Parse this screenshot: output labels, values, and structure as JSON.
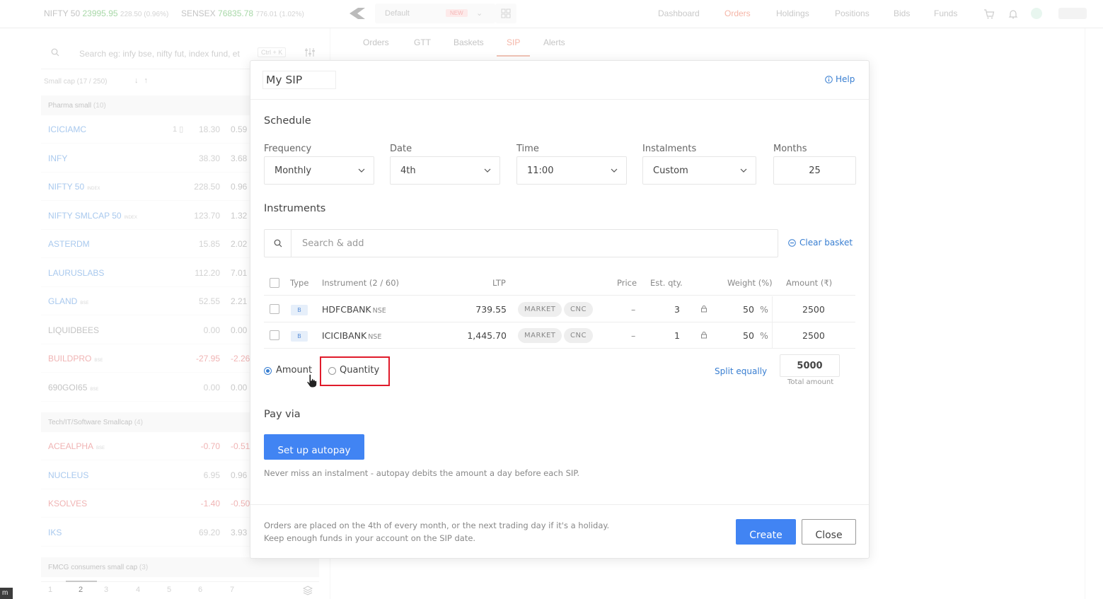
{
  "header": {
    "indices": [
      {
        "name": "NIFTY 50",
        "value": "23995.95",
        "change": "228.50 (0.96%)"
      },
      {
        "name": "SENSEX",
        "value": "76835.78",
        "change": "776.01 (1.02%)"
      }
    ],
    "marketwatch_select": {
      "value": "Default",
      "badge": "NEW"
    },
    "nav": [
      "Dashboard",
      "Orders",
      "Holdings",
      "Positions",
      "Bids",
      "Funds"
    ],
    "active_nav": "Orders"
  },
  "marketwatch": {
    "search_placeholder": "Search eg: infy bse, nifty fut, index fund, et",
    "shortcut": "Ctrl + K",
    "list_header": "Small cap (17 / 250)",
    "groups": [
      {
        "name": "Pharma small",
        "count": "(10)",
        "rows": [
          {
            "symbol": "ICICIAMC",
            "tag": "",
            "holding": "1",
            "ltp": "18.30",
            "pct": "0.59"
          },
          {
            "symbol": "INFY",
            "tag": "",
            "holding": "",
            "ltp": "38.30",
            "pct": "3.68"
          },
          {
            "symbol": "NIFTY 50",
            "tag": "INDEX",
            "holding": "",
            "ltp": "228.50",
            "pct": "0.96"
          },
          {
            "symbol": "NIFTY SMLCAP 50",
            "tag": "INDEX",
            "holding": "",
            "ltp": "123.70",
            "pct": "1.32"
          },
          {
            "symbol": "ASTERDM",
            "tag": "",
            "holding": "",
            "ltp": "15.85",
            "pct": "2.02"
          },
          {
            "symbol": "LAURUSLABS",
            "tag": "",
            "holding": "",
            "ltp": "112.20",
            "pct": "7.01"
          },
          {
            "symbol": "GLAND",
            "tag": "BSE",
            "holding": "",
            "ltp": "52.55",
            "pct": "2.21"
          },
          {
            "symbol": "LIQUIDBEES",
            "tag": "",
            "holding": "",
            "ltp": "0.00",
            "pct": "0.00"
          },
          {
            "symbol": "BUILDPRO",
            "tag": "BSE",
            "holding": "",
            "ltp": "-27.95",
            "pct": "-2.26"
          },
          {
            "symbol": "690GOI65",
            "tag": "BSE",
            "holding": "",
            "ltp": "0.00",
            "pct": "0.00"
          }
        ]
      },
      {
        "name": "Tech/IT/Software Smallcap",
        "count": "(4)",
        "rows": [
          {
            "symbol": "ACEALPHA",
            "tag": "BSE",
            "holding": "",
            "ltp": "-0.70",
            "pct": "-0.51"
          },
          {
            "symbol": "NUCLEUS",
            "tag": "",
            "holding": "",
            "ltp": "6.95",
            "pct": "0.96"
          },
          {
            "symbol": "KSOLVES",
            "tag": "",
            "holding": "",
            "ltp": "-1.40",
            "pct": "-0.50"
          },
          {
            "symbol": "IKS",
            "tag": "",
            "holding": "",
            "ltp": "69.20",
            "pct": "3.93"
          }
        ]
      },
      {
        "name": "FMCG consumers small cap",
        "count": "(3)",
        "rows": []
      }
    ],
    "pages": [
      "1",
      "2",
      "3",
      "4",
      "5",
      "6",
      "7"
    ],
    "active_page": "2"
  },
  "orders_tabs": [
    "Orders",
    "GTT",
    "Baskets",
    "SIP",
    "Alerts"
  ],
  "active_orders_tab": "SIP",
  "sip": {
    "name": "My SIP",
    "help": "Help",
    "schedule_title": "Schedule",
    "fields": [
      {
        "label": "Frequency",
        "value": "Monthly"
      },
      {
        "label": "Date",
        "value": "4th"
      },
      {
        "label": "Time",
        "value": "11:00"
      },
      {
        "label": "Instalments",
        "value": "Custom"
      },
      {
        "label": "Months",
        "value": "25"
      }
    ],
    "instruments_title": "Instruments",
    "search_placeholder": "Search & add",
    "clear_basket": "Clear basket",
    "table": {
      "headers": [
        "Type",
        "Instrument (2 / 60)",
        "LTP",
        "Price",
        "Est. qty.",
        "Weight (%)",
        "Amount (₹)"
      ],
      "rows": [
        {
          "type": "B",
          "instrument": "HDFCBANK",
          "exchange": "NSE",
          "ltp": "739.55",
          "order_type": "MARKET",
          "product": "CNC",
          "price": "–",
          "qty": "3",
          "weight": "50",
          "weight_unit": "%",
          "amount": "2500"
        },
        {
          "type": "B",
          "instrument": "ICICIBANK",
          "exchange": "NSE",
          "ltp": "1,445.70",
          "order_type": "MARKET",
          "product": "CNC",
          "price": "–",
          "qty": "1",
          "weight": "50",
          "weight_unit": "%",
          "amount": "2500"
        }
      ]
    },
    "mode_options": [
      {
        "label": "Amount",
        "selected": true
      },
      {
        "label": "Quantity",
        "selected": false
      }
    ],
    "split_equally": "Split equally",
    "total_amount": "5000",
    "total_amount_label": "Total amount",
    "pay_via_title": "Pay via",
    "autopay_button": "Set up autopay",
    "autopay_note": "Never miss an instalment - autopay debits the amount a day before each SIP.",
    "footer_notes": [
      "Orders are placed on the 4th of every month, or the next trading day if it's a holiday.",
      "Keep enough funds in your account on the SIP date."
    ],
    "create_button": "Create",
    "close_button": "Close"
  },
  "corner_label": "m",
  "colors": {
    "accent_blue": "#4184f3",
    "link_blue": "#387ed1",
    "highlight_red": "#e01b2b",
    "brand_orange": "#ff5722"
  }
}
